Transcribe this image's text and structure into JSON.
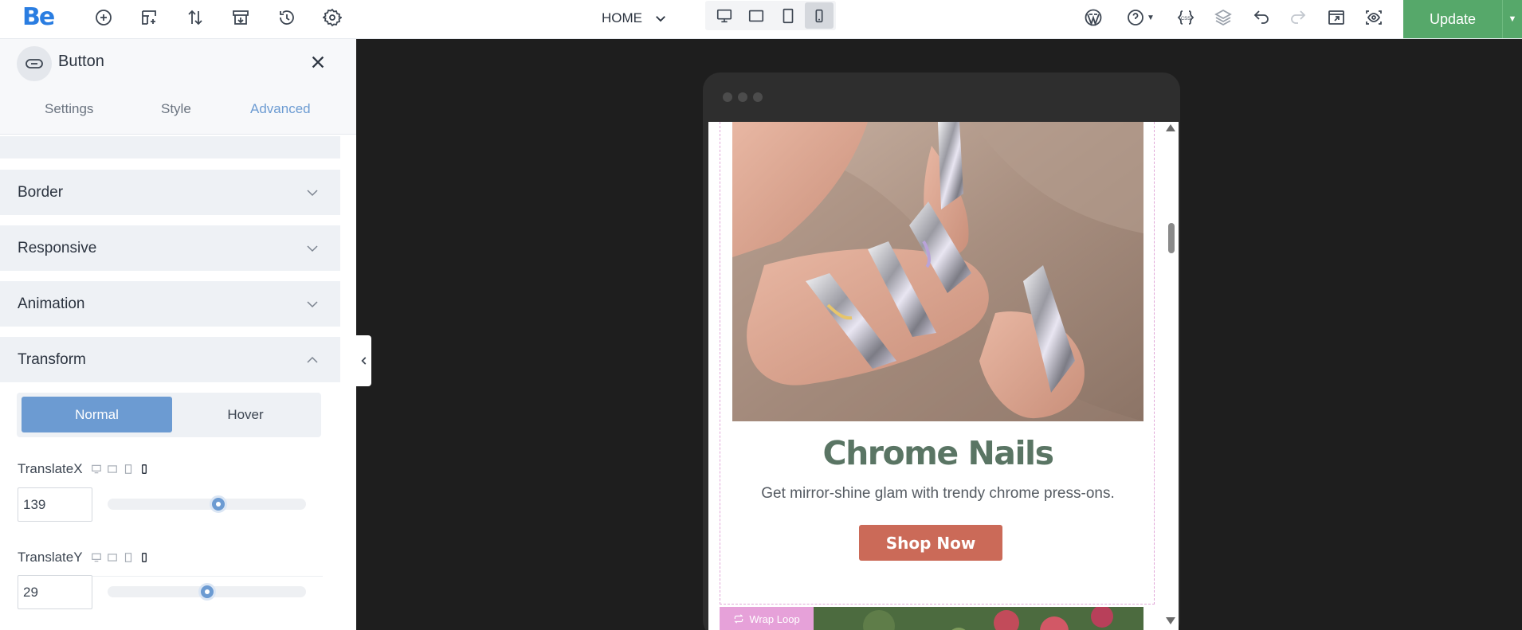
{
  "app": {
    "logo": "Be",
    "page_select": "HOME",
    "update_label": "Update"
  },
  "toolbar": {
    "icons": [
      "add-element-icon",
      "add-section-icon",
      "sort-icon",
      "templates-icon",
      "history-icon",
      "settings-icon"
    ],
    "devices": [
      "desktop-icon",
      "tablet-landscape-icon",
      "tablet-portrait-icon",
      "mobile-icon"
    ],
    "active_device": "mobile",
    "right_icons": [
      "wordpress-icon",
      "help-icon",
      "css-icon",
      "layers-icon",
      "undo-icon",
      "redo-icon",
      "export-icon",
      "preview-icon"
    ]
  },
  "panel": {
    "element_title": "Button",
    "tabs": [
      "Settings",
      "Style",
      "Advanced"
    ],
    "active_tab": "Advanced",
    "sections": [
      "Border",
      "Responsive",
      "Animation",
      "Transform"
    ],
    "expanded_section": "Transform",
    "state_toggle": [
      "Normal",
      "Hover"
    ],
    "active_state": "Normal",
    "controls": [
      {
        "label": "TranslateX",
        "value": "139"
      },
      {
        "label": "TranslateY",
        "value": "29"
      }
    ]
  },
  "preview": {
    "headline": "Chrome Nails",
    "subline": "Get mirror-shine glam with trendy chrome press-ons.",
    "button_label": "Shop Now",
    "wrap_tag": "Wrap Loop"
  },
  "colors": {
    "accent": "#6c9bd2",
    "update_green": "#56a86a",
    "headline_green": "#5a7564",
    "button_terracotta": "#cb6a58",
    "wrap_tag_pink": "#e6a1d9"
  }
}
